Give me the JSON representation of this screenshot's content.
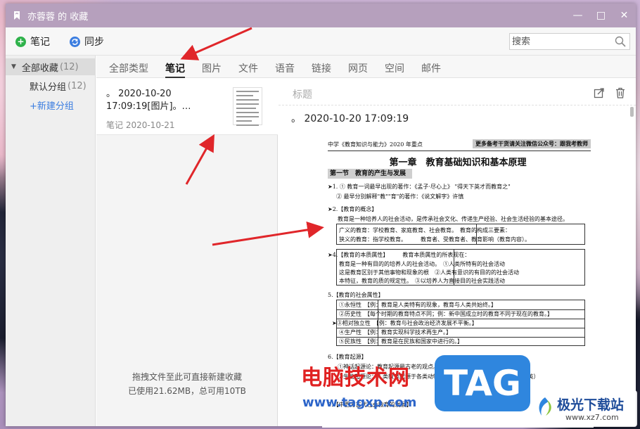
{
  "window": {
    "title": "亦蓉蓉 的 收藏",
    "controls": [
      "—",
      "□",
      "✕"
    ]
  },
  "toolbar": {
    "new_note_label": "笔记",
    "sync_label": "同步",
    "search_placeholder": "搜索"
  },
  "sidebar": {
    "all_label": "全部收藏",
    "all_count": "(12)",
    "default_group_label": "默认分组",
    "default_group_count": "(12)",
    "new_group_label": "+新建分组"
  },
  "tabs": [
    "全部类型",
    "笔记",
    "图片",
    "文件",
    "语音",
    "链接",
    "网页",
    "空间",
    "邮件"
  ],
  "active_tab": "笔记",
  "note_list": {
    "items": [
      {
        "title": "。 2020-10-20 17:09:19[图片]。…",
        "meta": "笔记 2020-10-21"
      }
    ],
    "footer_line1": "拖拽文件至此可直接新建收藏",
    "footer_line2": "已使用21.62MB，总可用10TB"
  },
  "detail": {
    "title_placeholder": "标题",
    "body_text": "。 2020-10-20 17:09:19"
  },
  "document": {
    "header_left": "中学《教育知识与能力》2020 年重点",
    "header_right": "更多备考干货请关注微信公众号：跟我考教师",
    "chapter": "第一章　教育基础知识和基本原理",
    "section": "第一节　教育的产生与发展",
    "lines": [
      "➤1. ① 教育一词最早出现的著作：《孟子·尽心上》 \"得天下英才而教育之\"",
      "② 最早分别解释\"教\"\"育\"的著作：《说文解字》许慎",
      "➤2.【教育的概念】",
      "教育是一种培养人的社会活动，是传承社会文化、传递生产经验、社会生活经验的基本途径。",
      "广义的教育：学校教育、家庭教育、社会教育。　教育的构成三要素：",
      "狭义的教育：指学校教育。　　　教育者、受教育者、教育影响（教育内容）。",
      "➤4.【教育的本质属性】　　　教育本质属性的所表现在：",
      "教育是一种有目的的培养人的社会活动。　①人类所特有的社会活动",
      "这是教育区别于其他事物和现象的根　②人类有意识的有目的的社会活动",
      "本特征，教育的质的规定性。　③以培养人为直接目的社会实践活动",
      "5.【教育的社会属性】",
      "①永恒性　【例：教育是人类特有的现象，教育与人类共始终。】",
      "②历史性　【每个时期的教育特点不同；例：新中国成立时的教育不同于现在的教育。】",
      "➤③相对独立性　【例：教育与社会政治经济发展不平衡。】",
      "④生产性　【例：教育实现科学技术再生产。】",
      "⑤民族性　【例：教育是在民族和国家中进行的。】",
      "6.【教育起源】",
      "①神话起源论：教育起源最古老的观点。",
      "②生物起源论：人类教育起源于各类动物的本能活动。（利托尔诺）沛西·能（英）",
      "7.【中西方古代社会教育的发展】"
    ]
  },
  "watermarks": {
    "cn_site": "电脑技术网",
    "url": "www.tagxp.com",
    "tag": "TAG",
    "logo_cn": "极光下载站",
    "logo_url": "www.xz7.com"
  },
  "colors": {
    "titlebar": "#b6a0bd",
    "new_note_icon": "#2fb24b",
    "sync_icon": "#3b7de0",
    "arrow": "#e0262a",
    "link_blue": "#3b7de0"
  }
}
